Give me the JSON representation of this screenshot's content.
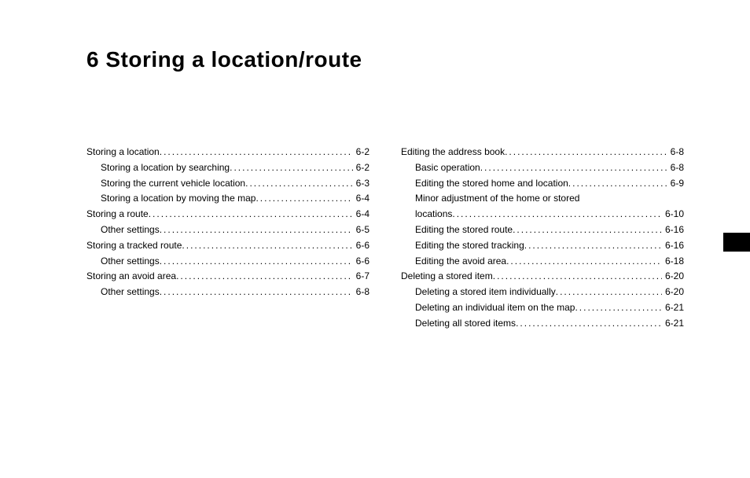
{
  "chapter": {
    "number": "6",
    "title": "Storing a location/route"
  },
  "toc": {
    "left": [
      {
        "label": "Storing a location",
        "page": "6-2",
        "level": 0
      },
      {
        "label": "Storing a location by searching",
        "page": "6-2",
        "level": 1
      },
      {
        "label": "Storing the current vehicle location",
        "page": "6-3",
        "level": 1
      },
      {
        "label": "Storing a location by moving the map",
        "page": "6-4",
        "level": 1
      },
      {
        "label": "Storing a route",
        "page": "6-4",
        "level": 0
      },
      {
        "label": "Other settings",
        "page": "6-5",
        "level": 1
      },
      {
        "label": "Storing a tracked route",
        "page": "6-6",
        "level": 0
      },
      {
        "label": "Other settings",
        "page": "6-6",
        "level": 1
      },
      {
        "label": "Storing an avoid area",
        "page": "6-7",
        "level": 0
      },
      {
        "label": "Other settings",
        "page": "6-8",
        "level": 1
      }
    ],
    "right": [
      {
        "label": "Editing the address book",
        "page": "6-8",
        "level": 0
      },
      {
        "label": "Basic operation",
        "page": "6-8",
        "level": 1
      },
      {
        "label": "Editing the stored home and location",
        "page": "6-9",
        "level": 1
      },
      {
        "label_a": "Minor adjustment of the home or stored",
        "label_b": "locations",
        "page": "6-10",
        "level": 1,
        "wrap": true
      },
      {
        "label": "Editing the stored route",
        "page": "6-16",
        "level": 1
      },
      {
        "label": "Editing the stored tracking",
        "page": "6-16",
        "level": 1
      },
      {
        "label": "Editing the avoid area",
        "page": "6-18",
        "level": 1
      },
      {
        "label": "Deleting a stored item",
        "page": "6-20",
        "level": 0
      },
      {
        "label": "Deleting a stored item individually",
        "page": "6-20",
        "level": 1
      },
      {
        "label": "Deleting an individual item on the map",
        "page": "6-21",
        "level": 1
      },
      {
        "label": "Deleting all stored items",
        "page": "6-21",
        "level": 1
      }
    ]
  }
}
